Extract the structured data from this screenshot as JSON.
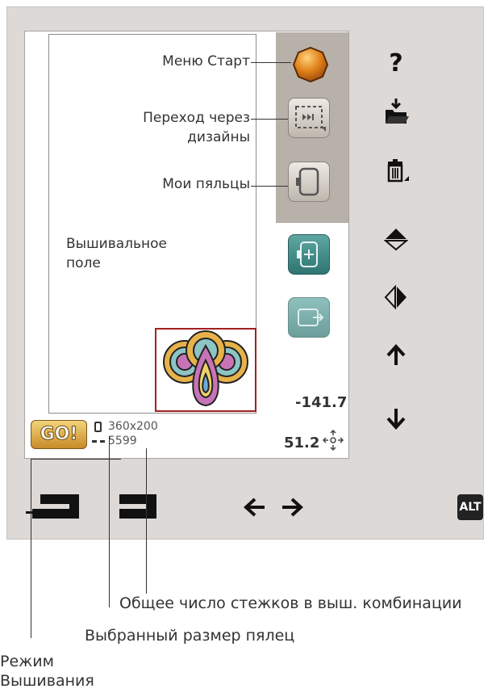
{
  "callouts": {
    "start_menu": "Меню Старт",
    "design_nav_line1": "Переход через",
    "design_nav_line2": "дизайны",
    "my_hoops": "Мои пяльцы",
    "field_line1": "Вышивальное",
    "field_line2": "поле"
  },
  "status": {
    "go_label": "GO!",
    "hoop_size": "360x200",
    "stitch_count": "5599",
    "pos_y": "-141.7",
    "pos_x": "51.2"
  },
  "toolbar": {
    "help": "?",
    "alt_label": "ALT"
  },
  "captions": {
    "total_stitches": "Общее число стежков в выш. комбинации",
    "selected_hoop": "Выбранный размер пялец",
    "mode_line1": "Режим",
    "mode_line2": "Вышивания"
  },
  "colors": {
    "frame": "#ddd9d6",
    "teal": "#2f7571",
    "go": "#e1a642",
    "start_orb": "#d97a12",
    "hoop_rect": "#a32020"
  },
  "icons": [
    "start-orb-icon",
    "design-nav-icon",
    "hoop-icon",
    "add-hoop-icon",
    "move-hoop-icon",
    "help-icon",
    "open-folder-icon",
    "delete-icon",
    "flip-vertical-icon",
    "flip-horizontal-icon",
    "arrow-up-icon",
    "arrow-down-icon",
    "move-cross-icon",
    "sewing-mode-icon",
    "embroidery-mode-icon",
    "arrow-left-icon",
    "arrow-right-icon"
  ]
}
